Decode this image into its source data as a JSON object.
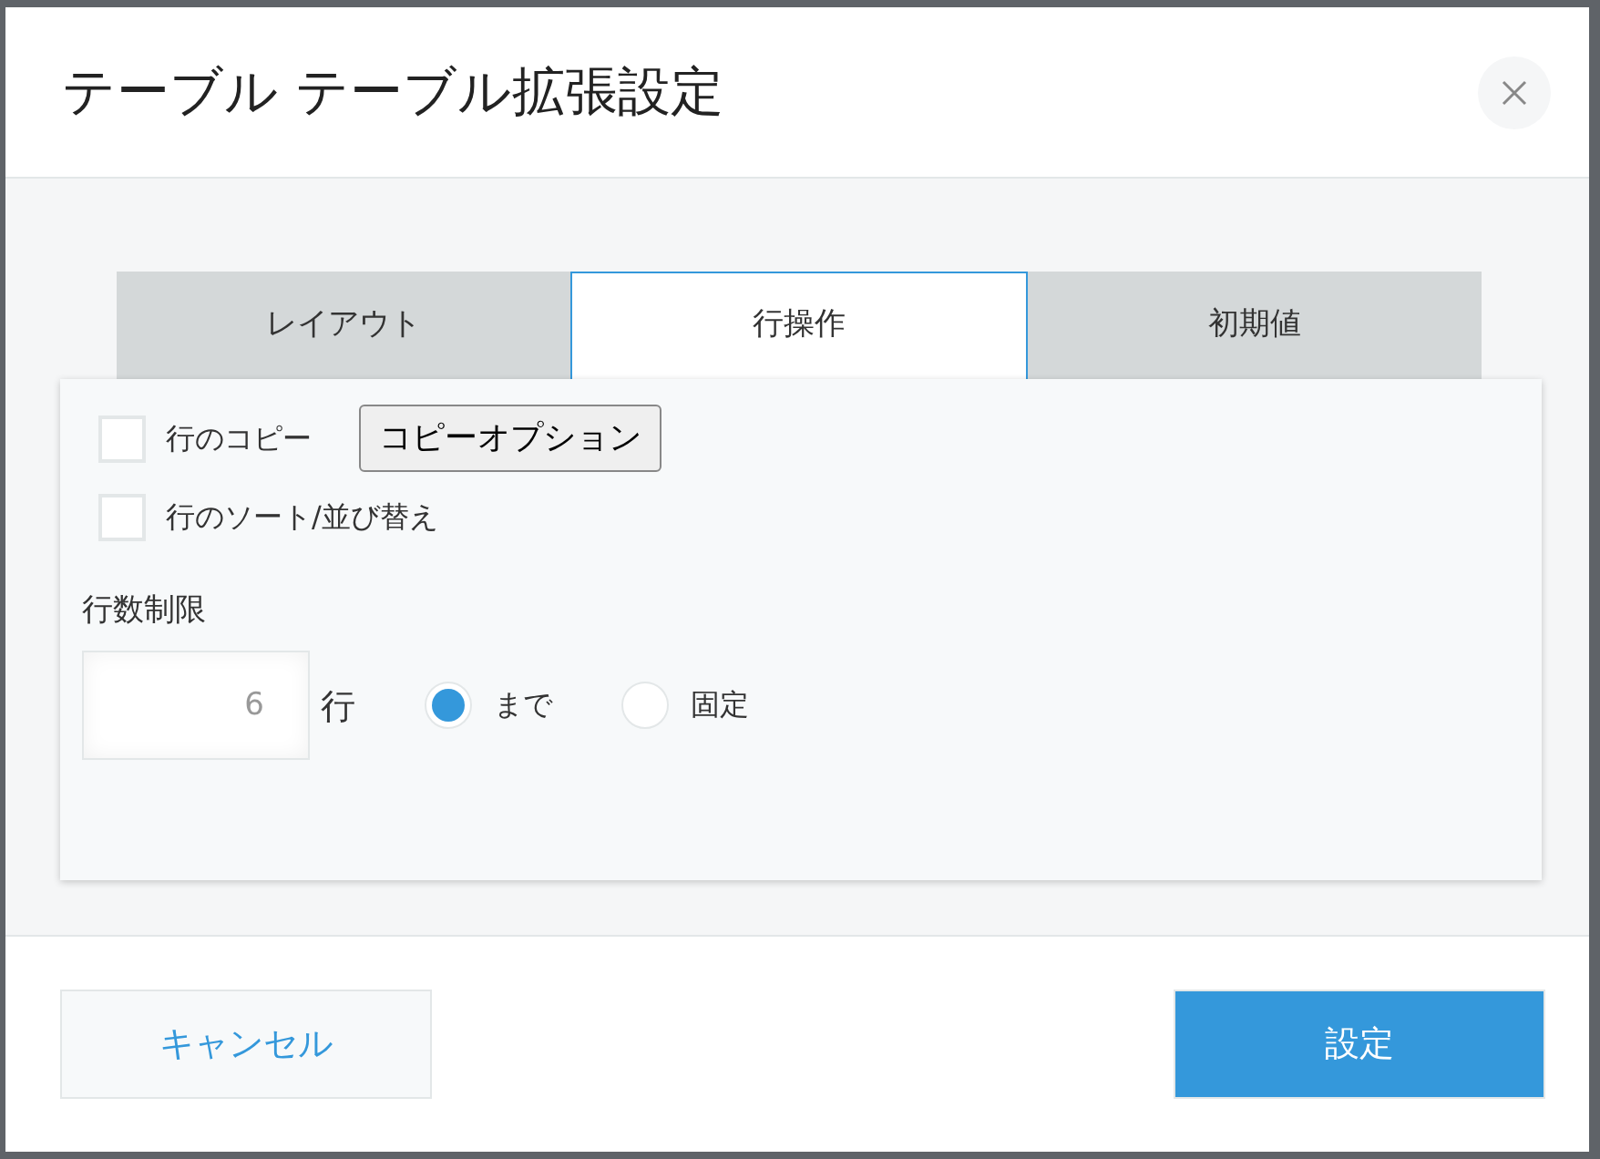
{
  "dialog": {
    "title": "テーブル テーブル拡張設定"
  },
  "tabs": [
    {
      "label": "レイアウト",
      "selected": false
    },
    {
      "label": "行操作",
      "selected": true
    },
    {
      "label": "初期値",
      "selected": false
    }
  ],
  "options": [
    {
      "label": "行のコピー",
      "checked": false,
      "button": "コピーオプション"
    },
    {
      "label": "行のソート/並び替え",
      "checked": false
    }
  ],
  "row_limit": {
    "label": "行数制限",
    "value": "6",
    "unit": "行",
    "modes": [
      {
        "label": "まで",
        "selected": true
      },
      {
        "label": "固定",
        "selected": false
      }
    ]
  },
  "footer": {
    "cancel": "キャンセル",
    "submit": "設定"
  }
}
